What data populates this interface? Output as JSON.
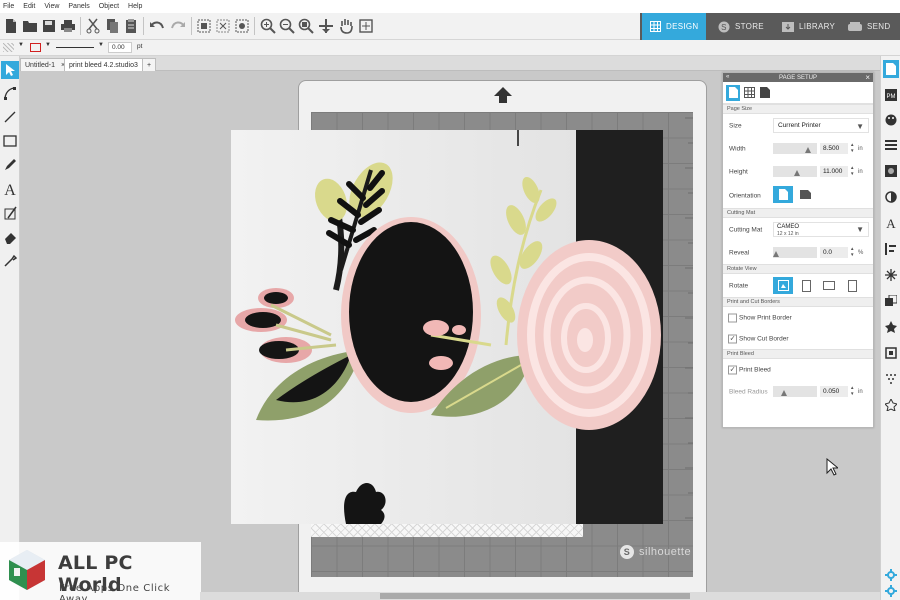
{
  "menu": [
    "File",
    "Edit",
    "View",
    "Panels",
    "Object",
    "Help"
  ],
  "nav_tabs": [
    {
      "label": "DESIGN",
      "icon": "grid-icon"
    },
    {
      "label": "STORE",
      "icon": "silhouette-s-icon"
    },
    {
      "label": "LIBRARY",
      "icon": "library-download-icon"
    },
    {
      "label": "SEND",
      "icon": "cutter-icon"
    }
  ],
  "style_bar": {
    "line_width": "0.00",
    "unit": "pt"
  },
  "document_tabs": [
    {
      "label": "Untitled-1",
      "close": "×"
    },
    {
      "label": "print bleed 4.2.studio3",
      "close": "×"
    }
  ],
  "add_tab": "+",
  "page_setup": {
    "title": "PAGE SETUP",
    "close": "×",
    "collapse": "«",
    "sections": {
      "page_size": "Page Size",
      "cutting_mat": "Cutting Mat",
      "rotate_view": "Rotate View",
      "borders": "Print and Cut Borders",
      "bleed": "Print Bleed"
    },
    "size": {
      "label": "Size",
      "value": "Current Printer"
    },
    "width": {
      "label": "Width",
      "value": "8.500",
      "unit": "in",
      "level": 0.85
    },
    "height": {
      "label": "Height",
      "value": "11.000",
      "unit": "in",
      "level": 0.55
    },
    "orientation": {
      "label": "Orientation"
    },
    "mat": {
      "label": "Cutting Mat",
      "value": "CAMEO",
      "sub": "12 x 12 in"
    },
    "reveal": {
      "label": "Reveal",
      "value": "0.0",
      "unit": "%",
      "level": 0.0
    },
    "rotate": {
      "label": "Rotate"
    },
    "show_print_border": {
      "label": "Show Print Border",
      "checked": false
    },
    "show_cut_border": {
      "label": "Show Cut Border",
      "checked": true
    },
    "print_bleed": {
      "label": "Print Bleed",
      "checked": true
    },
    "bleed_radius": {
      "label": "Bleed Radius",
      "value": "0.050",
      "unit": "in",
      "level": 0.2
    }
  },
  "mat_brand": {
    "logo": "S",
    "text": "silhouette"
  },
  "watermark": {
    "title": "ALL PC World",
    "subtitle": "Free Apps One Click Away"
  },
  "colors": {
    "accent": "#34a9dc",
    "nav_bg": "#5a5a5a",
    "mat_grid": "#8b8b8b",
    "flower_pink": "#f1c9c6",
    "leaf_green": "#8fa06a",
    "leaf_yellow": "#d9d98c",
    "ink_black": "#141414"
  }
}
